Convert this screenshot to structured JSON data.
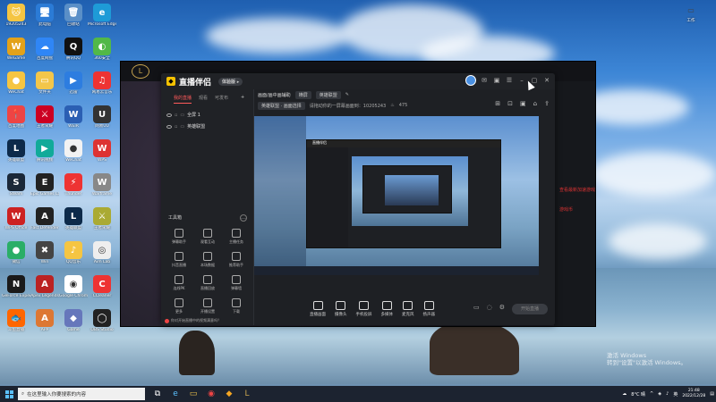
{
  "desktop": {
    "icons": [
      {
        "label": "19205243",
        "glyph": "🐱",
        "bg": "#f5c542"
      },
      {
        "label": "此电脑",
        "glyph": "🖥",
        "bg": "#2b7bd6"
      },
      {
        "label": "回收站",
        "glyph": "🗑",
        "bg": "#5a8fc7"
      },
      {
        "label": "Microsoft Edge",
        "glyph": "e",
        "bg": "#1e9bd7"
      },
      {
        "label": "WeGame",
        "glyph": "W",
        "bg": "#e3a21a"
      },
      {
        "label": "百度网盘",
        "glyph": "☁",
        "bg": "#2f86f6"
      },
      {
        "label": "腾讯QQ",
        "glyph": "Q",
        "bg": "#111"
      },
      {
        "label": "360安全",
        "glyph": "◐",
        "bg": "#52b848"
      },
      {
        "label": "WeChat",
        "glyph": "●",
        "bg": "#f5c542"
      },
      {
        "label": "文件夹",
        "glyph": "▭",
        "bg": "#f3c64a"
      },
      {
        "label": "迅雷",
        "glyph": "▶",
        "bg": "#2d7de0"
      },
      {
        "label": "网易云音乐",
        "glyph": "♫",
        "bg": "#e33"
      },
      {
        "label": "百度地图",
        "glyph": "📍",
        "bg": "#e44"
      },
      {
        "label": "王者荣耀",
        "glyph": "⚔",
        "bg": "#c02"
      },
      {
        "label": "WEIR",
        "glyph": "W",
        "bg": "#2b5fb3"
      },
      {
        "label": "网易UU",
        "glyph": "U",
        "bg": "#333"
      },
      {
        "label": "英雄联盟",
        "glyph": "L",
        "bg": "#0d2a4a"
      },
      {
        "label": "腾讯视频",
        "glyph": "▶",
        "bg": "#1a9"
      },
      {
        "label": "WeChat",
        "glyph": "●",
        "bg": "#f2f2f2"
      },
      {
        "label": "WPS",
        "glyph": "W",
        "bg": "#d33"
      },
      {
        "label": "Steam",
        "glyph": "S",
        "bg": "#1b2838"
      },
      {
        "label": "Epic Games Launcher",
        "glyph": "E",
        "bg": "#222"
      },
      {
        "label": "Thunder",
        "glyph": "⚡",
        "bg": "#e33"
      },
      {
        "label": "Warframe",
        "glyph": "W",
        "bg": "#888"
      },
      {
        "label": "WPS Office",
        "glyph": "W",
        "bg": "#c22"
      },
      {
        "label": "Fast Defender",
        "glyph": "A",
        "bg": "#222"
      },
      {
        "label": "英雄联盟",
        "glyph": "L",
        "bg": "#0d2a4a"
      },
      {
        "label": "王者荣耀",
        "glyph": "⚔",
        "bg": "#aa3"
      },
      {
        "label": "微信",
        "glyph": "●",
        "bg": "#2aae67"
      },
      {
        "label": "Win",
        "glyph": "✖",
        "bg": "#444"
      },
      {
        "label": "QQ音乐",
        "glyph": "♪",
        "bg": "#f5c542"
      },
      {
        "label": "Aim Lab",
        "glyph": "◎",
        "bg": "#eee"
      },
      {
        "label": "GeForce Experience",
        "glyph": "N",
        "bg": "#1a1a1a"
      },
      {
        "label": "Apex Legends",
        "glyph": "A",
        "bg": "#b22"
      },
      {
        "label": "Google Chrome",
        "glyph": "◉",
        "bg": "#fff"
      },
      {
        "label": "CCleaner",
        "glyph": "C",
        "bg": "#e33"
      },
      {
        "label": "斗鱼直播",
        "glyph": "🐟",
        "bg": "#f60"
      },
      {
        "label": "APP",
        "glyph": "A",
        "bg": "#d73"
      },
      {
        "label": "Game",
        "glyph": "◆",
        "bg": "#67b"
      },
      {
        "label": "OBS Studio",
        "glyph": "◯",
        "bg": "#222"
      }
    ],
    "right_icon": {
      "label": "工作",
      "glyph": "▭",
      "bg": "#f3c64a"
    }
  },
  "game_window": {
    "logo": "L",
    "red_text_1": "查看最新加速游戏",
    "red_text_2": "游戏币"
  },
  "app": {
    "brand": "直播伴侣",
    "version_pill": "体验版 ▸",
    "left_tabs": [
      "我的直播",
      "观看",
      "可发布"
    ],
    "scenes": [
      {
        "name": "全屏 1"
      },
      {
        "name": "英雄联盟"
      }
    ],
    "tools_title": "工具箱",
    "tools": [
      {
        "label": "弹幕助手"
      },
      {
        "label": "观看互动"
      },
      {
        "label": "主播任务"
      },
      {
        "label": "抖音直播"
      },
      {
        "label": "本场数据"
      },
      {
        "label": "推荐助手"
      },
      {
        "label": "连线PK"
      },
      {
        "label": "直播回放"
      },
      {
        "label": "弹幕墙"
      },
      {
        "label": "更多"
      },
      {
        "label": "开播设置"
      },
      {
        "label": "下载"
      }
    ],
    "bottom_note": "你对开始直播中的视频满意吗？",
    "toolbar": {
      "label": "画面/画中画辅助",
      "pill_1": "横屏",
      "pill_2": "英雄联盟",
      "scene_pill": "英雄联盟 · 画面选择",
      "hint": "请拖动你的一屏幕画面到：10205243",
      "count": "475"
    },
    "bottom_actions": [
      {
        "label": "直播画面"
      },
      {
        "label": "摄像头"
      },
      {
        "label": "手机投屏"
      },
      {
        "label": "多媒体"
      },
      {
        "label": "麦克风"
      },
      {
        "label": "扬声器"
      }
    ],
    "start_button": "开始直播"
  },
  "windows": {
    "activate_line1": "激活 Windows",
    "activate_line2": "转到\"设置\"以激活 Windows。"
  },
  "taskbar": {
    "search_placeholder": "在这里输入你要搜索的内容",
    "weather": "8°C 晴",
    "time": "21:48",
    "date": "2022/12/28",
    "lang": "英"
  }
}
